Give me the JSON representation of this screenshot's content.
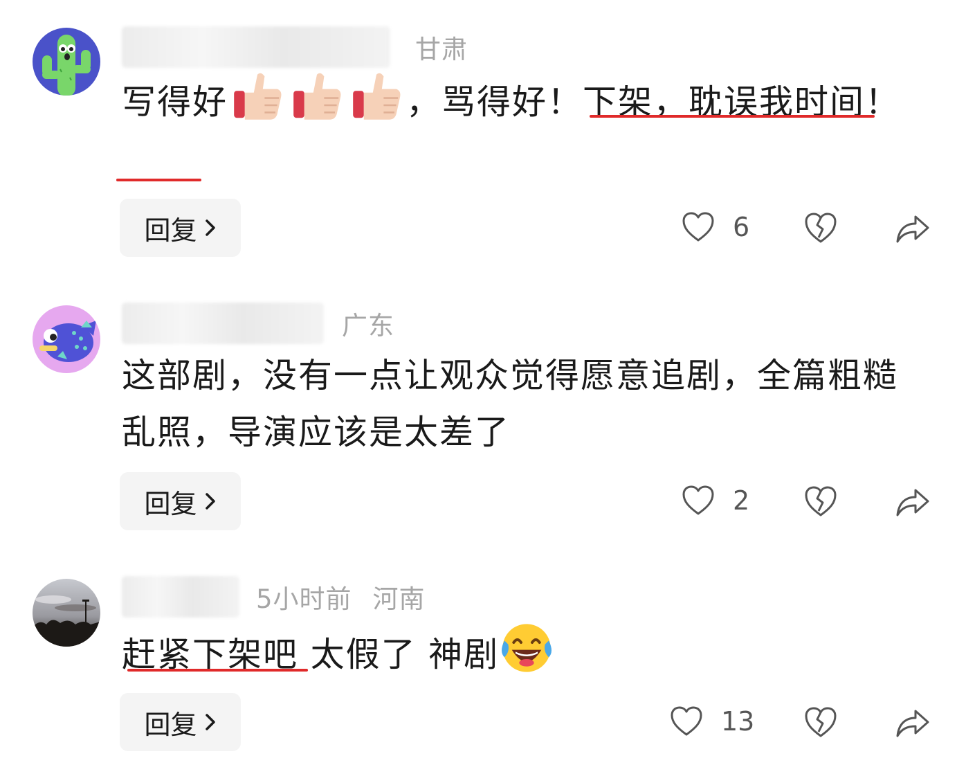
{
  "comments": [
    {
      "location": "甘肃",
      "time": "",
      "text_part1": "写得好",
      "text_part2": "，骂得好！",
      "text_part3": "下架，耽误我时间！",
      "likes": "6",
      "reply_label": "回复",
      "emoji": "thumbs-up x3"
    },
    {
      "location": "广东",
      "time": "",
      "text": "这部剧，没有一点让观众觉得愿意追剧，全篇粗糙乱照，导演应该是太差了",
      "likes": "2",
      "reply_label": "回复"
    },
    {
      "location": "河南",
      "time": "5小时前",
      "text_part1": "赶紧下架吧",
      "text_part2": " 太假了 神剧",
      "likes": "13",
      "reply_label": "回复",
      "emoji": "tears-of-joy"
    }
  ],
  "icons": {
    "like": "heart-outline-icon",
    "dislike": "broken-heart-icon",
    "share": "share-arrow-icon",
    "reply_chevron": "chevron-right-icon"
  },
  "colors": {
    "highlight_underline": "#e02a2a",
    "meta_text": "#a6a6a6",
    "reply_bg": "#f4f4f4"
  }
}
